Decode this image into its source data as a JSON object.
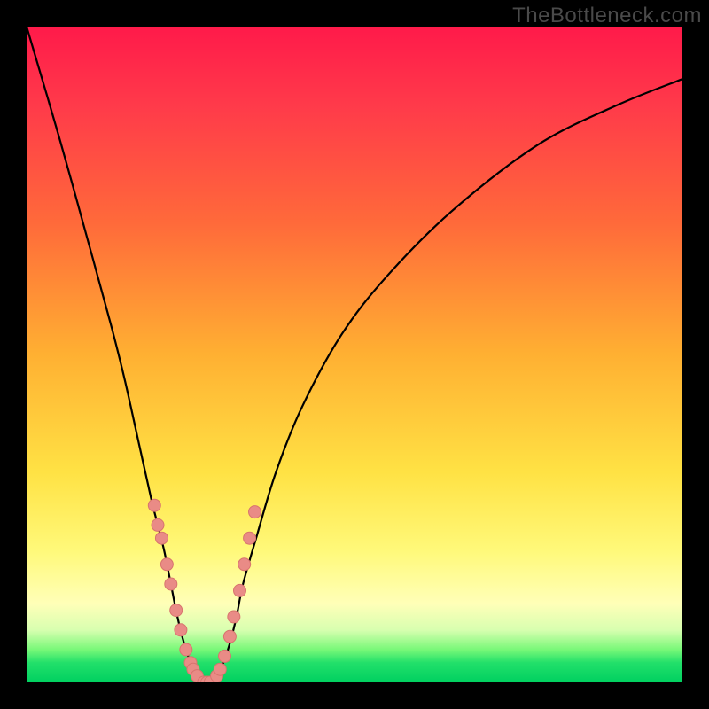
{
  "watermark": "TheBottleneck.com",
  "colors": {
    "frame": "#000000",
    "curve": "#000000",
    "dot_fill": "#e98b86",
    "dot_stroke": "#d8746e"
  },
  "chart_data": {
    "type": "line",
    "title": "",
    "xlabel": "",
    "ylabel": "",
    "xlim": [
      0,
      100
    ],
    "ylim": [
      0,
      100
    ],
    "grid": false,
    "legend": false,
    "series": [
      {
        "name": "bottleneck-curve",
        "x": [
          0,
          5,
          10,
          13,
          15,
          17,
          19,
          20,
          21,
          22,
          23,
          24,
          25,
          26,
          27,
          28,
          29,
          30,
          31,
          32,
          33,
          35,
          38,
          42,
          48,
          55,
          65,
          78,
          90,
          100
        ],
        "y": [
          100,
          83,
          65,
          54,
          46,
          37,
          28,
          24,
          20,
          15,
          10,
          6,
          3,
          1,
          0,
          0,
          1,
          3,
          6,
          10,
          15,
          22,
          32,
          42,
          53,
          62,
          72,
          82,
          88,
          92
        ]
      }
    ],
    "scatter_points": {
      "name": "markers",
      "x": [
        19.5,
        20.0,
        20.6,
        21.4,
        22.0,
        22.8,
        23.5,
        24.3,
        25.0,
        25.4,
        26.0,
        27.0,
        27.5,
        28.0,
        29.0,
        29.5,
        30.2,
        31.0,
        31.6,
        32.5,
        33.2,
        34.0,
        34.8
      ],
      "y": [
        27,
        24,
        22,
        18,
        15,
        11,
        8,
        5,
        3,
        2,
        1,
        0,
        0,
        0,
        1,
        2,
        4,
        7,
        10,
        14,
        18,
        22,
        26
      ]
    }
  }
}
